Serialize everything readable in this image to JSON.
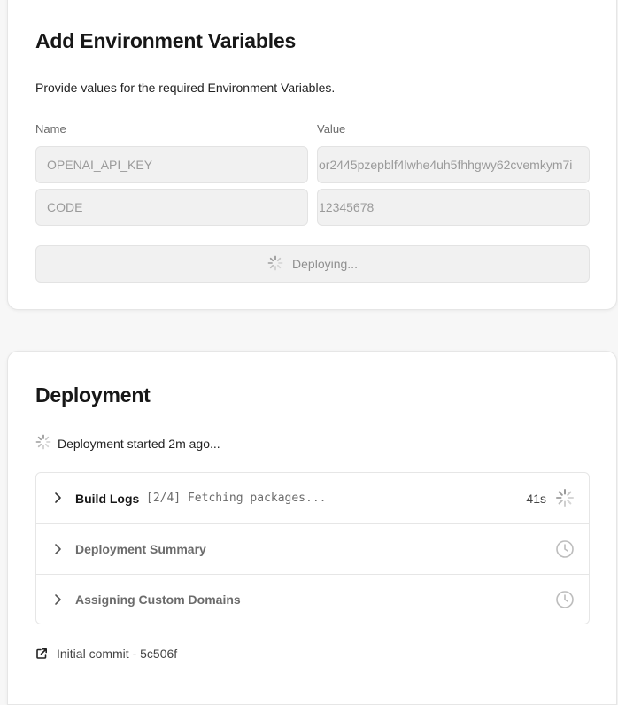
{
  "env_section": {
    "title": "Add Environment Variables",
    "description": "Provide values for the required Environment Variables.",
    "name_label": "Name",
    "value_label": "Value",
    "variables": [
      {
        "name": "OPENAI_API_KEY",
        "value": "or2445pzepblf4lwhe4uh5fhhgwy62cvemkym7i"
      },
      {
        "name": "CODE",
        "value": "12345678"
      }
    ],
    "deploy_button": {
      "label": "Deploying...",
      "icon": "spinner-icon"
    }
  },
  "deployment": {
    "title": "Deployment",
    "status": "Deployment started 2m ago...",
    "status_icon": "spinner-icon",
    "steps": [
      {
        "label": "Build Logs",
        "message": "[2/4] Fetching packages...",
        "time": "41s",
        "status": "in-progress",
        "icon": "spinner-icon"
      },
      {
        "label": "Deployment Summary",
        "status": "pending",
        "icon": "clock-icon"
      },
      {
        "label": "Assigning Custom Domains",
        "status": "pending",
        "icon": "clock-icon"
      }
    ],
    "commit": {
      "label": "Initial commit - 5c506f",
      "icon": "external-link-icon"
    }
  }
}
